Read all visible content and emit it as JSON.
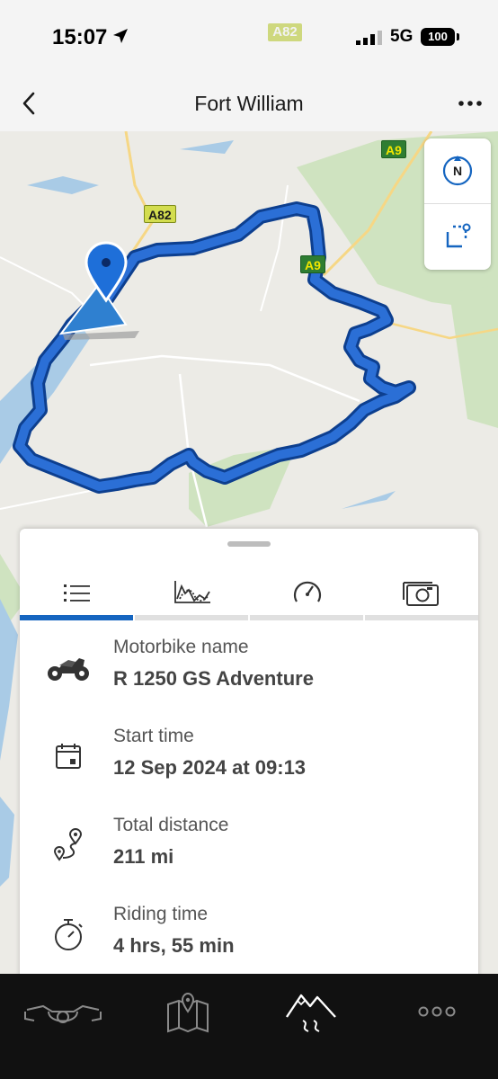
{
  "status_bar": {
    "time": "15:07",
    "road_label": "A82",
    "network": "5G",
    "battery": "100"
  },
  "header": {
    "title": "Fort William"
  },
  "map": {
    "road_labels": [
      "A82",
      "A9",
      "A9"
    ],
    "route_color": "#1565c0",
    "controls": [
      "compass-north-icon",
      "select-area-icon"
    ]
  },
  "sheet": {
    "tabs": [
      {
        "name": "details-list-icon",
        "active": true
      },
      {
        "name": "elevation-chart-icon",
        "active": false
      },
      {
        "name": "speedometer-icon",
        "active": false
      },
      {
        "name": "camera-icon",
        "active": false
      }
    ],
    "rows": [
      {
        "icon": "motorbike-icon",
        "label": "Motorbike name",
        "value": "R 1250 GS Adventure"
      },
      {
        "icon": "calendar-icon",
        "label": "Start time",
        "value": "12 Sep 2024 at 09:13"
      },
      {
        "icon": "route-distance-icon",
        "label": "Total distance",
        "value": "211 mi"
      },
      {
        "icon": "stopwatch-icon",
        "label": "Riding time",
        "value": "4 hrs, 55 min"
      }
    ]
  },
  "bottom_nav": {
    "items": [
      "motorbike-dashboard-icon",
      "map-icon",
      "rides-mountain-icon",
      "more-dots-icon"
    ],
    "active_index": 2
  },
  "colors": {
    "accent": "#1565c0",
    "route": "#1565c0",
    "bottom_bar": "#111111"
  }
}
